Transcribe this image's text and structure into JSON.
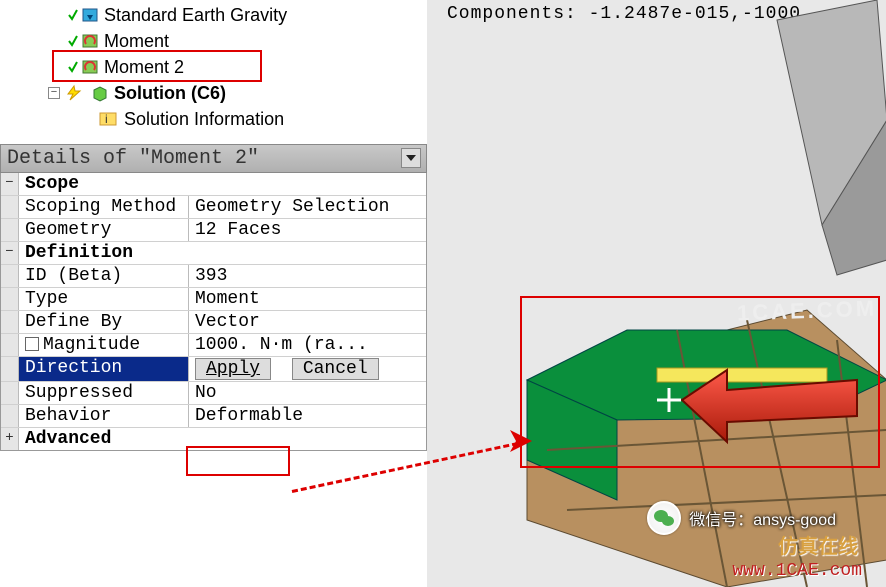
{
  "tree": {
    "gravity": "Standard Earth Gravity",
    "moment": "Moment",
    "moment2": "Moment 2",
    "solution": "Solution (C6)",
    "solinfo": "Solution Information"
  },
  "details_title": "Details of \"Moment 2\"",
  "details": {
    "scope_hdr": "Scope",
    "scoping_method_l": "Scoping Method",
    "scoping_method_v": "Geometry Selection",
    "geometry_l": "Geometry",
    "geometry_v": "12 Faces",
    "def_hdr": "Definition",
    "id_l": "ID (Beta)",
    "id_v": "393",
    "type_l": "Type",
    "type_v": "Moment",
    "defineby_l": "Define By",
    "defineby_v": "Vector",
    "mag_l": "Magnitude",
    "mag_v": "1000. N·m  (ra...",
    "dir_l": "Direction",
    "dir_apply": "Apply",
    "dir_cancel": "Cancel",
    "supp_l": "Suppressed",
    "supp_v": "No",
    "behav_l": "Behavior",
    "behav_v": "Deformable",
    "adv_hdr": "Advanced"
  },
  "right": {
    "components": "Components:  -1.2487e-015,-1000.",
    "wechat_label": "微信号：",
    "wechat_id": "ansys-good",
    "brand": "仿真在线",
    "url": "www.1CAE.com"
  },
  "watermark": "1CAE.COM"
}
